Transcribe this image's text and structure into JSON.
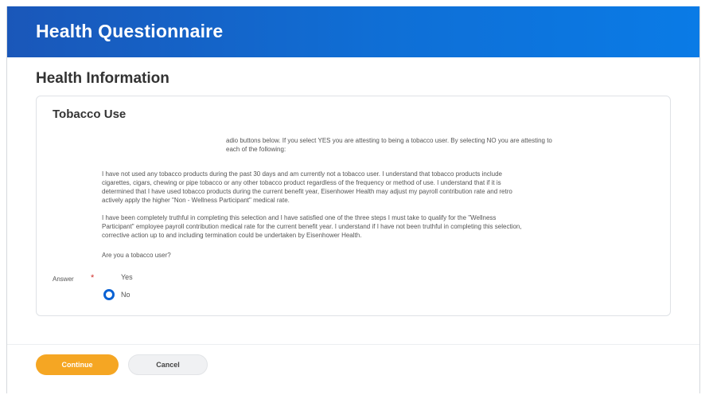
{
  "header": {
    "title": "Health Questionnaire"
  },
  "section": {
    "title": "Health Information"
  },
  "card": {
    "title": "Tobacco Use",
    "intro_lines": [
      "adio buttons below. If you select YES you are attesting to being a tobacco user. By selecting NO you are attesting to",
      "each of the following:"
    ],
    "paragraph1_lines": [
      "I have not used any tobacco products during the past 30 days and am currently not a tobacco user. I understand that tobacco products include",
      "cigarettes, cigars, chewing or pipe tobacco or any other tobacco product regardless of the frequency or method of use. I understand that if it is",
      "determined that I have used tobacco products during the current benefit year, Eisenhower Health may adjust my payroll contribution rate and retro",
      "actively apply the higher \"Non - Wellness Participant\" medical rate."
    ],
    "paragraph2_lines": [
      "I have been completely truthful in completing this selection and I have satisfied one of the three steps I must take to qualify for the \"Wellness",
      "Participant\" employee payroll contribution medical rate for the current benefit year. I understand if I have not been truthful in completing this selection,",
      "corrective action up to and including termination could be undertaken by Eisenhower Health."
    ],
    "question": "Are you a tobacco user?",
    "answer": {
      "label": "Answer",
      "required_marker": "*",
      "options": [
        {
          "label": "Yes",
          "selected": false
        },
        {
          "label": "No",
          "selected": true
        }
      ]
    }
  },
  "footer": {
    "continue_label": "Continue",
    "cancel_label": "Cancel"
  },
  "colors": {
    "header": "#1a57b9",
    "continue": "#f5a623",
    "radio_selected": "#0a62d4",
    "required": "#d0312d"
  }
}
